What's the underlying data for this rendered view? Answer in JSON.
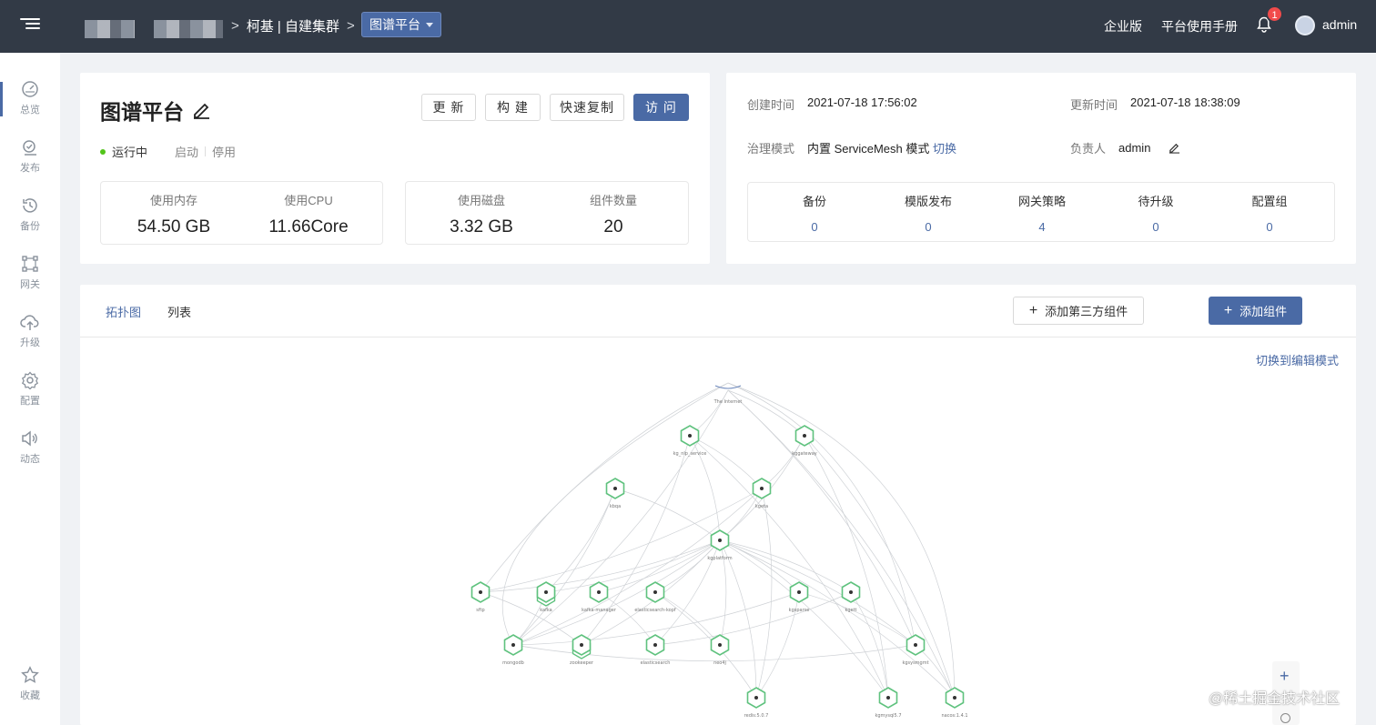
{
  "header": {
    "breadcrumb": {
      "sep": ">",
      "team": "柯基 | 自建集群"
    },
    "app_selector": "图谱平台",
    "links": {
      "enterprise": "企业版",
      "manual": "平台使用手册"
    },
    "notifications": "1",
    "user": "admin"
  },
  "sidebar": {
    "items": [
      {
        "label": "总览",
        "icon": "dashboard-icon"
      },
      {
        "label": "发布",
        "icon": "publish-icon"
      },
      {
        "label": "备份",
        "icon": "backup-icon"
      },
      {
        "label": "网关",
        "icon": "gateway-icon"
      },
      {
        "label": "升级",
        "icon": "upgrade-icon"
      },
      {
        "label": "配置",
        "icon": "settings-icon"
      },
      {
        "label": "动态",
        "icon": "activity-icon"
      },
      {
        "label": "收藏",
        "icon": "star-icon"
      }
    ]
  },
  "app": {
    "name": "图谱平台",
    "buttons": {
      "update": "更 新",
      "build": "构 建",
      "copy": "快速复制",
      "visit": "访 问"
    },
    "status": "运行中",
    "actions": {
      "start": "启动",
      "stop": "停用"
    },
    "stats": [
      {
        "label": "使用内存",
        "value": "54.50 GB"
      },
      {
        "label": "使用CPU",
        "value": "11.66Core"
      },
      {
        "label": "使用磁盘",
        "value": "3.32 GB"
      },
      {
        "label": "组件数量",
        "value": "20"
      }
    ]
  },
  "info": {
    "created_label": "创建时间",
    "created": "2021-07-18 17:56:02",
    "updated_label": "更新时间",
    "updated": "2021-07-18 18:38:09",
    "governance_label": "治理模式",
    "governance": "内置 ServiceMesh 模式",
    "switch": "切换",
    "owner_label": "负责人",
    "owner": "admin",
    "counters": [
      {
        "label": "备份",
        "value": "0"
      },
      {
        "label": "模版发布",
        "value": "0"
      },
      {
        "label": "网关策略",
        "value": "4"
      },
      {
        "label": "待升级",
        "value": "0"
      },
      {
        "label": "配置组",
        "value": "0"
      }
    ]
  },
  "topology": {
    "tabs": {
      "graph": "拓扑图",
      "list": "列表"
    },
    "add_third_party": "添加第三方组件",
    "add_component": "添加组件",
    "edit_mode": "切换到编辑模式",
    "nodes": [
      "The Internet",
      "kg_nlp_service",
      "kggateway",
      "kbqa",
      "kgeta",
      "kgplatform",
      "sftp",
      "kafka",
      "kafka-manager",
      "elasticsearch-kopf",
      "kgsparse",
      "kgett",
      "mongodb",
      "zookeeper",
      "elasticsearch",
      "neo4j",
      "kgsysmgmt",
      "redis:5.0.7",
      "kgmysql5.7",
      "nacos:1.4.1"
    ]
  },
  "watermark": "@稀土掘金技术社区",
  "colors": {
    "topbar": "#323a46",
    "accent": "#4a6aa5",
    "node": "#5fc27e",
    "running": "#52c41a",
    "badge": "#f14b4b"
  }
}
